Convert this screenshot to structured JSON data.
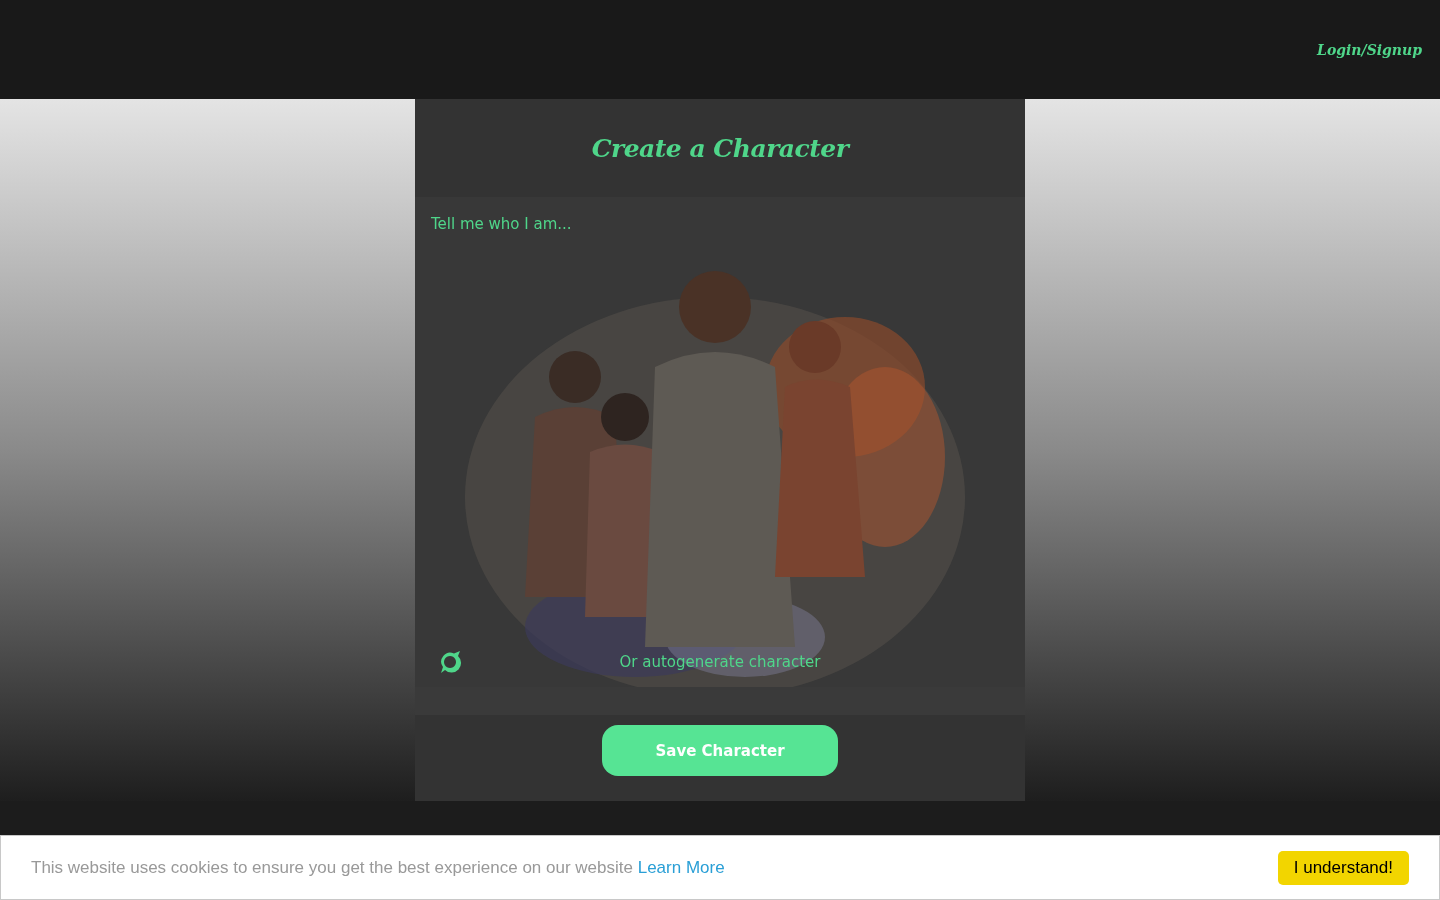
{
  "header": {
    "auth_link": "Login/Signup"
  },
  "panel": {
    "title": "Create a Character",
    "description": {
      "placeholder": "Tell me who I am..."
    },
    "autogenerate": {
      "label": "Or autogenerate character"
    },
    "save_button": "Save Character"
  },
  "cookie_banner": {
    "message": "This website uses cookies to ensure you get the best experience on our website",
    "link": "Learn More",
    "button": "I understand!"
  }
}
